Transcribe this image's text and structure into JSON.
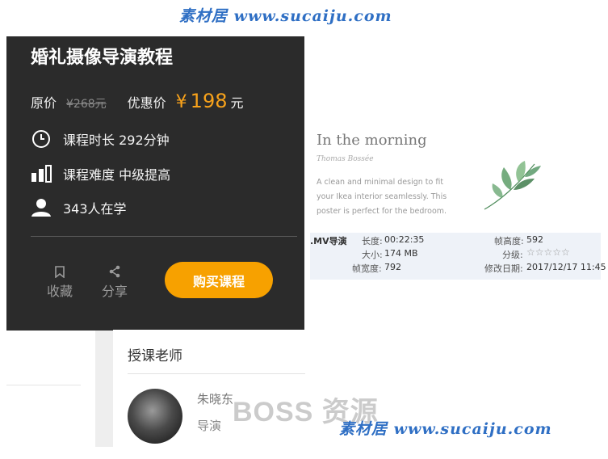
{
  "watermark": {
    "top": "素材居 www.sucaiju.com",
    "bottom": "素材居 www.sucaiju.com",
    "overlay": "BOSS 资源"
  },
  "course": {
    "title": "婚礼摄像导演教程",
    "original_price_label": "原价",
    "original_price": "¥268元",
    "discount_label": "优惠价",
    "currency": "¥",
    "discount_price": "198",
    "price_unit": "元",
    "duration": "课程时长 292分钟",
    "difficulty": "课程难度 中级提高",
    "learners": "343人在学",
    "favorite_label": "收藏",
    "share_label": "分享",
    "buy_label": "购买课程"
  },
  "poster": {
    "title": "In the morning",
    "author": "Thomas Bossée",
    "description": "A clean and minimal design to fit your Ikea interior seamlessly. This poster is perfect for the bedroom."
  },
  "file_meta": {
    "name": ".MV导演",
    "duration_key": "长度:",
    "duration_val": "00:22:35",
    "frame_height_key": "帧高度:",
    "frame_height_val": "592",
    "size_key": "大小:",
    "size_val": "174 MB",
    "rating_key": "分级:",
    "rating_stars": "☆☆☆☆☆",
    "frame_width_key": "帧宽度:",
    "frame_width_val": "792",
    "modified_key": "修改日期:",
    "modified_val": "2017/12/17 11:45"
  },
  "teacher": {
    "heading": "授课老师",
    "name": "朱晓东",
    "role": "导演"
  }
}
